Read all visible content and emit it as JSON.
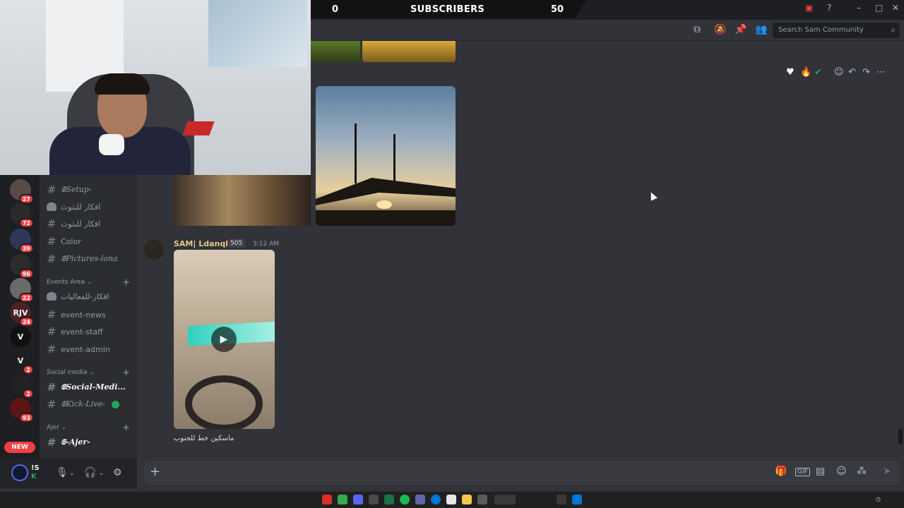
{
  "overlay": {
    "left_count": "0",
    "label": "SUBSCRIBERS",
    "right_count": "50"
  },
  "header": {
    "search_placeholder": "Search Sam Community"
  },
  "servers": [
    {
      "badge": "27"
    },
    {
      "badge": "72"
    },
    {
      "badge": "39"
    },
    {
      "badge": "96"
    },
    {
      "badge": "22"
    },
    {
      "badge": "24",
      "label": "RJV"
    },
    {
      "badge": "",
      "label": "V"
    },
    {
      "badge": "2",
      "label": "V"
    },
    {
      "badge": "2"
    },
    {
      "badge": "93"
    }
  ],
  "new_badge": "NEW",
  "channels": {
    "setup": "𝕾Setup-",
    "idea1": "افكار للبثوث",
    "idea2": "افكار للبثوث",
    "color": "Color",
    "pictures": "𝕾Pictures-lona",
    "events_area": "Events Area",
    "events_ideas": "افكار-للفعاليات",
    "event_news": "event-news",
    "event_staff": "event-staff",
    "event_admin": "event-admin",
    "social_cat": "Social media",
    "social_channel": "𝕾Social-Medi...",
    "kick_channel": "𝕾Kick-Live-",
    "ajer_cat": "Ajer",
    "ajer_channel": "𝕾-Ajer-"
  },
  "user": {
    "name": "!S",
    "tag": "K"
  },
  "message": {
    "author": "SAM| Ldanqht",
    "role_count": "505",
    "time": "3:12 AM",
    "caption": "ماسكين خط للجنوب"
  },
  "colors": {
    "accent": "#5865f2",
    "author": "#e3c88a",
    "badge": "#f23f43",
    "online": "#23a55a"
  }
}
